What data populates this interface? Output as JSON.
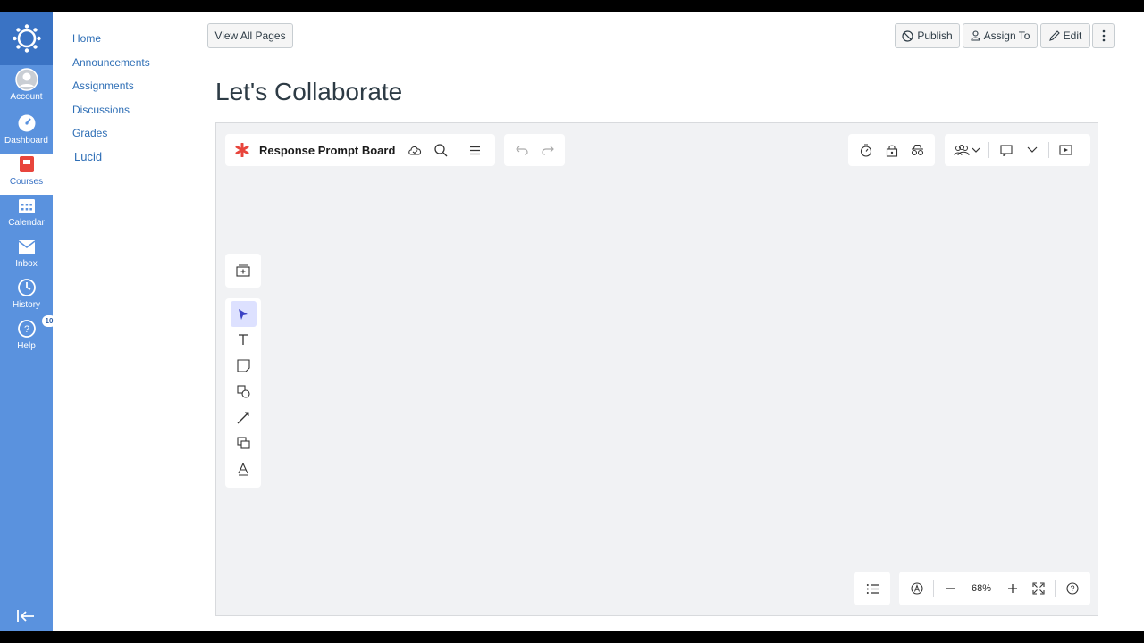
{
  "global_nav": {
    "items": [
      {
        "label": "Account"
      },
      {
        "label": "Dashboard"
      },
      {
        "label": "Courses"
      },
      {
        "label": "Calendar"
      },
      {
        "label": "Inbox"
      },
      {
        "label": "History"
      },
      {
        "label": "Help",
        "badge": "10"
      }
    ]
  },
  "course_nav": {
    "items": [
      "Home",
      "Announcements",
      "Assignments",
      "Discussions",
      "Grades",
      "Lucid"
    ]
  },
  "header": {
    "view_all_pages": "View All Pages",
    "publish": "Publish",
    "assign_to": "Assign To",
    "edit": "Edit"
  },
  "page": {
    "title": "Let's Collaborate"
  },
  "lucid": {
    "board_title": "Response Prompt Board",
    "zoom": "68%"
  },
  "colors": {
    "nav_bg": "#5a92de",
    "nav_active_bg": "#3a73c4",
    "lucid_red": "#e8453c",
    "link": "#2f6fb6"
  }
}
